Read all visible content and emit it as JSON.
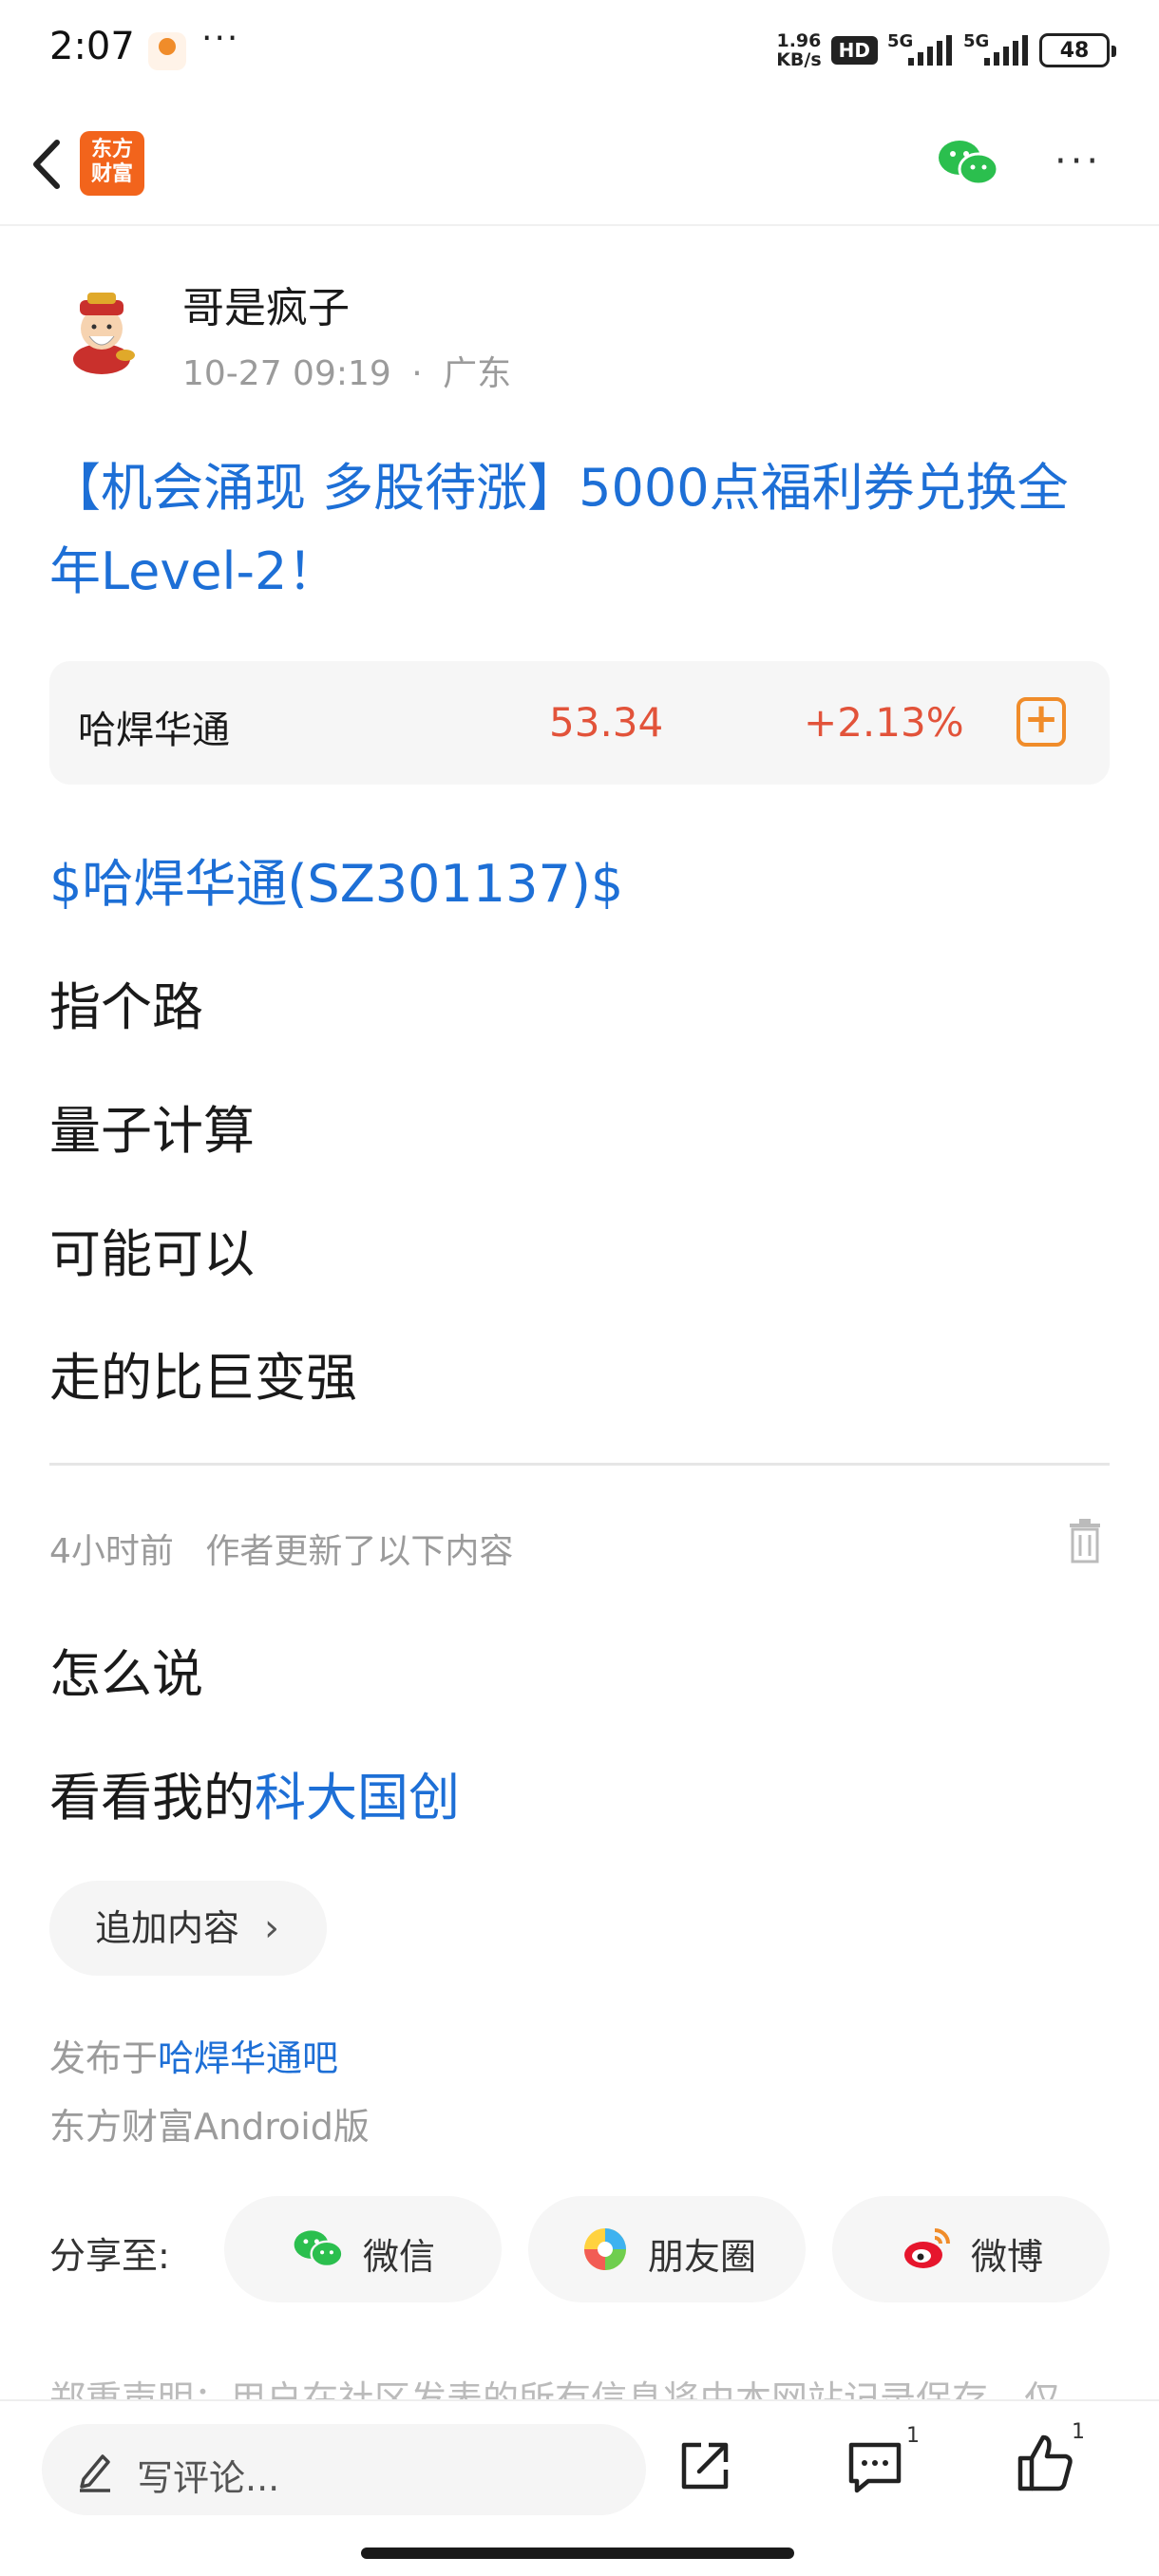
{
  "status_bar": {
    "time": "2:07",
    "dots": "···",
    "net_speed_value": "1.96",
    "net_speed_unit": "KB/s",
    "hd_label": "HD",
    "signal1_label": "5G",
    "signal2_label": "5G",
    "battery": "48"
  },
  "nav": {
    "logo_line1": "东方",
    "logo_line2": "财富",
    "more": "···"
  },
  "post": {
    "author_name": "哥是疯子",
    "time": "10-27 09:19",
    "separator": "·",
    "location": "广东",
    "title": "【机会涌现 多股待涨】5000点福利券兑换全年Level-2！",
    "stock": {
      "name": "哈焊华通",
      "price": "53.34",
      "change": "+2.13%",
      "add_icon": "+"
    },
    "stock_link": "$哈焊华通(SZ301137)$",
    "lines": [
      "指个路",
      "量子计算",
      "可能可以",
      "走的比巨变强"
    ],
    "update_time": "4小时前",
    "update_note": "作者更新了以下内容",
    "update_line1": "怎么说",
    "update_line2_prefix": "看看我的",
    "update_line2_link": "科大国创",
    "add_content_label": "追加内容",
    "add_content_chevron": "›",
    "posted_in_prefix": "发布于",
    "posted_in_link": "哈焊华通吧",
    "platform": "东方财富Android版"
  },
  "share": {
    "label": "分享至:",
    "wechat": "微信",
    "moments": "朋友圈",
    "weibo": "微博"
  },
  "disclaimer": "郑重声明：用户在社区发表的所有信息将由本网站记录保存，仅",
  "bottom_bar": {
    "comment_placeholder": "写评论...",
    "comment_count": "1",
    "like_count": "1"
  },
  "colors": {
    "link_blue": "#1d6fd6",
    "up_red": "#e2533a",
    "accent_orange": "#f08c2a",
    "brand_orange": "#f2641c"
  },
  "icons": [
    "back-arrow-icon",
    "wechat-icon",
    "more-icon",
    "trash-icon",
    "pen-icon",
    "share-out-icon",
    "comment-icon",
    "thumbs-up-icon",
    "moments-icon",
    "weibo-icon"
  ]
}
